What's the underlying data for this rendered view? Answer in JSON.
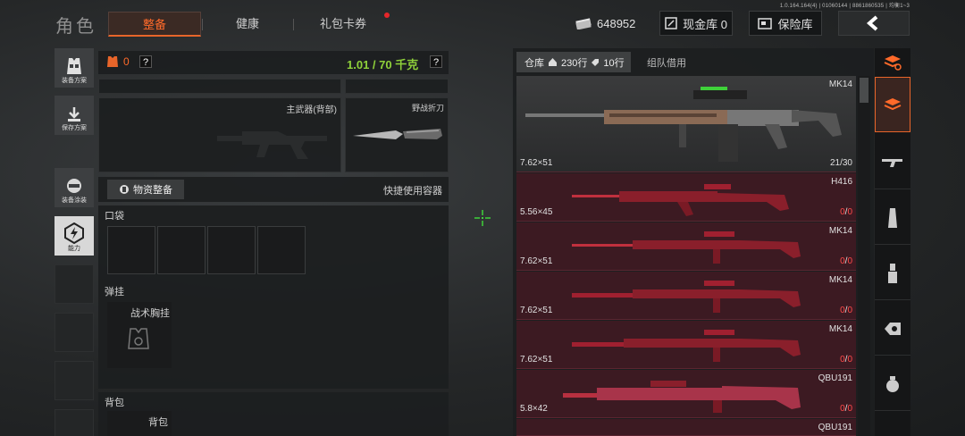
{
  "build_info": "1.0.164.164(4) | 01060144 | 8861860535 | 均衡1~3",
  "header": {
    "title": "角色",
    "tabs": [
      {
        "label": "整备"
      },
      {
        "label": "健康"
      },
      {
        "label": "礼包卡券"
      }
    ],
    "currency": "648952",
    "cash_vault": "现金库 0",
    "safe_box": "保险库"
  },
  "sidebar": {
    "items": [
      {
        "label": "装备方案"
      },
      {
        "label": "保存方案"
      },
      {
        "label": "装备涂装"
      },
      {
        "label": "能力"
      }
    ]
  },
  "loadout": {
    "armor_count": "0",
    "armor_help": "?",
    "weight": "1.01 / 70 千克",
    "weight_help": "?",
    "primary_label": "主武器(背部)",
    "melee_label": "野战折刀",
    "supply_button": "物资整备",
    "quick_container": "快捷使用容器",
    "pocket_label": "口袋",
    "rig_label": "弹挂",
    "rig_item": "战术胸挂",
    "backpack_label": "背包",
    "backpack_item": "背包"
  },
  "warehouse": {
    "tab_label": "仓库",
    "rows_count": "230行",
    "tag_rows": "10行",
    "team_borrow": "组队借用",
    "rows": [
      {
        "name": "MK14",
        "caliber": "7.62×51",
        "count": "21",
        "max": "30"
      },
      {
        "name": "H416",
        "caliber": "5.56×45",
        "count": "0",
        "max": "0"
      },
      {
        "name": "MK14",
        "caliber": "7.62×51",
        "count": "0",
        "max": "0"
      },
      {
        "name": "MK14",
        "caliber": "7.62×51",
        "count": "0",
        "max": "0"
      },
      {
        "name": "MK14",
        "caliber": "7.62×51",
        "count": "0",
        "max": "0"
      },
      {
        "name": "QBU191",
        "caliber": "5.8×42",
        "count": "0",
        "max": "0"
      },
      {
        "name": "QBU191",
        "caliber": "",
        "count": "",
        "max": ""
      }
    ]
  },
  "colors": {
    "accent": "#ff6a2a",
    "weight_green": "#8fd13a",
    "row_red": "#3c1a22",
    "zero_red": "#ff4a4a"
  }
}
